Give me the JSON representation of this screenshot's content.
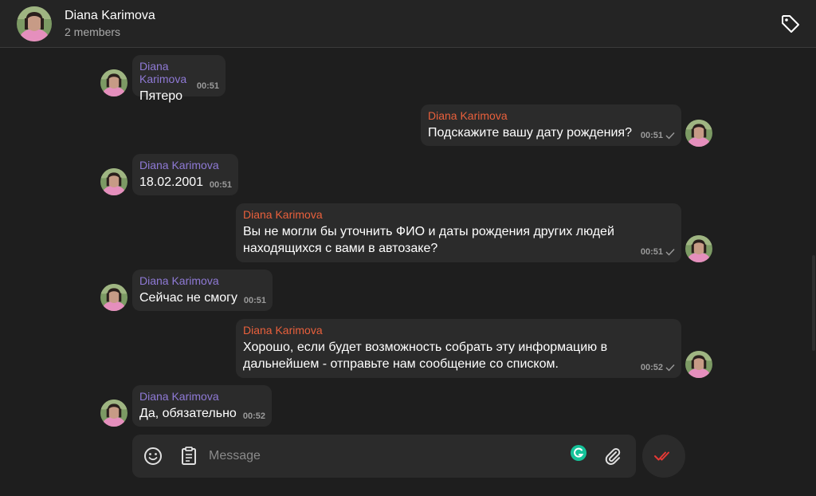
{
  "header": {
    "title": "Diana Karimova",
    "subtitle": "2 members"
  },
  "messages": [
    {
      "direction": "in",
      "sender": "Diana Karimova",
      "text": "Пятеро",
      "time": "00:51"
    },
    {
      "direction": "out",
      "sender": "Diana Karimova",
      "text": "Подскажите вашу дату рождения?",
      "time": "00:51",
      "read": true
    },
    {
      "direction": "in",
      "sender": "Diana Karimova",
      "text": "18.02.2001",
      "time": "00:51"
    },
    {
      "direction": "out",
      "sender": "Diana Karimova",
      "text_line1": "Вы не могли бы уточнить ФИО и даты рождения других людей",
      "text_line2": "находящихся с вами в автозаке?",
      "time": "00:51",
      "read": true
    },
    {
      "direction": "in",
      "sender": "Diana Karimova",
      "text": "Сейчас не смогу",
      "time": "00:51"
    },
    {
      "direction": "out",
      "sender": "Diana Karimova",
      "text_line1": "Хорошо, если будет возможность собрать эту информацию в",
      "text_line2": "дальнейшем - отправьте нам сообщение со списком.",
      "time": "00:52",
      "read": true
    },
    {
      "direction": "in",
      "sender": "Diana Karimova",
      "text": "Да, обязательно",
      "time": "00:52"
    }
  ],
  "composer": {
    "placeholder": "Message",
    "value": ""
  },
  "icons": {
    "tag": "tag-icon",
    "emoji": "smile-icon",
    "clipboard": "clipboard-icon",
    "grammarly": "grammarly-icon",
    "attach": "paperclip-icon",
    "send": "double-check-icon",
    "read_status": "check-icon"
  },
  "colors": {
    "background": "#1e1e1e",
    "bubble": "#2b2b2b",
    "sender_in": "#8f7ad6",
    "sender_out": "#e9603c",
    "send_accent": "#e53935",
    "grammarly": "#15c39a"
  }
}
